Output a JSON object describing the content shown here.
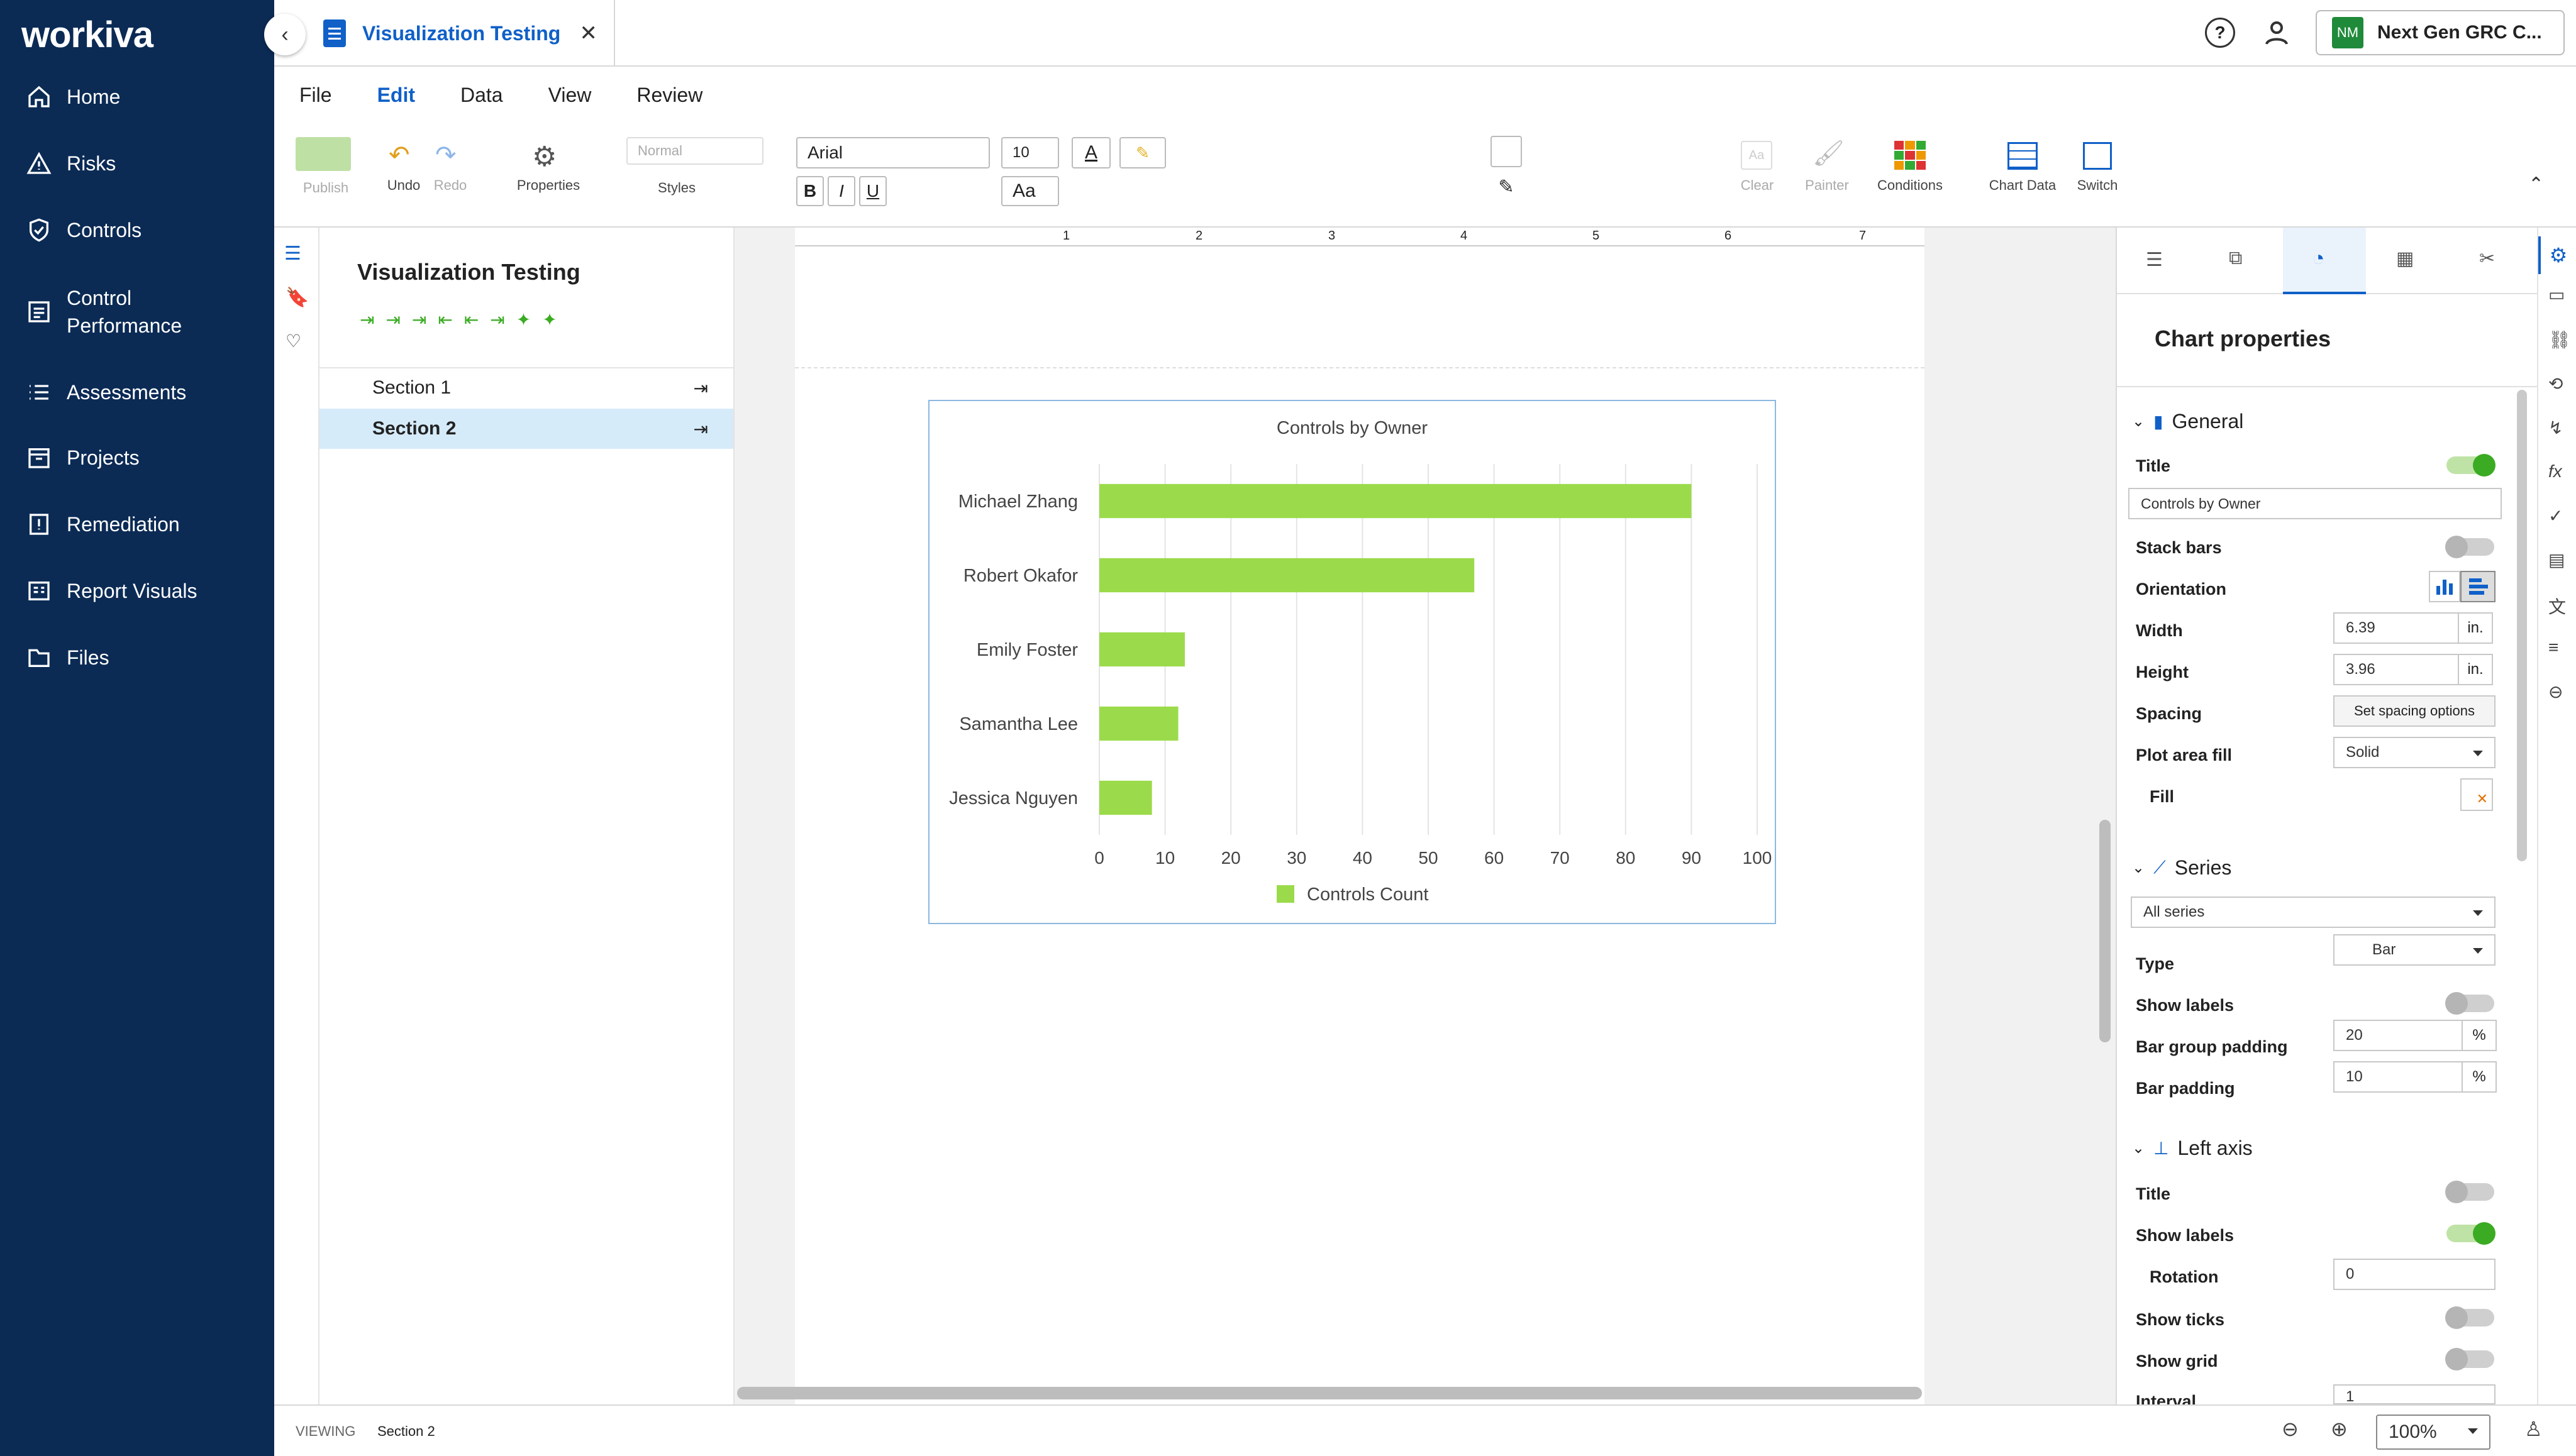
{
  "brand": {
    "logo": "workiva",
    "nav_bg": "#0b2b55",
    "accent": "#1060c8",
    "chart_green": "#9bdb4b"
  },
  "nav": {
    "items": [
      {
        "label": "Home",
        "icon": "home-icon"
      },
      {
        "label": "Risks",
        "icon": "warning-icon"
      },
      {
        "label": "Controls",
        "icon": "shield-icon"
      },
      {
        "label": "Control",
        "label2": "Performance",
        "icon": "performance-icon"
      },
      {
        "label": "Assessments",
        "icon": "list-icon"
      },
      {
        "label": "Projects",
        "icon": "projects-icon"
      },
      {
        "label": "Remediation",
        "icon": "remediation-icon"
      },
      {
        "label": "Report Visuals",
        "icon": "report-icon"
      },
      {
        "label": "Files",
        "icon": "folder-icon"
      }
    ]
  },
  "doc_tab": {
    "title": "Visualization Testing"
  },
  "account": {
    "initials": "NM",
    "name": "Next Gen GRC C..."
  },
  "menu": [
    "File",
    "Edit",
    "Data",
    "View",
    "Review"
  ],
  "toolbar": {
    "publish": "Publish",
    "undo": "Undo",
    "redo": "Redo",
    "properties": "Properties",
    "style_value": "Normal",
    "styles": "Styles",
    "font": "Arial",
    "size": "10",
    "case": "Aa",
    "clear": "Clear",
    "painter": "Painter",
    "conditions": "Conditions",
    "chart_data": "Chart Data",
    "switch": "Switch"
  },
  "outline": {
    "title": "Visualization Testing",
    "sections": [
      "Section 1",
      "Section 2"
    ]
  },
  "ruler": {
    "marks": [
      "1",
      "2",
      "3",
      "4",
      "5",
      "6",
      "7"
    ]
  },
  "chart_data": {
    "type": "bar",
    "orientation": "horizontal",
    "title": "Controls by Owner",
    "categories": [
      "Michael Zhang",
      "Robert Okafor",
      "Emily Foster",
      "Samantha Lee",
      "Jessica Nguyen"
    ],
    "series": [
      {
        "name": "Controls Count",
        "values": [
          90,
          57,
          13,
          12,
          8
        ]
      }
    ],
    "xlim": [
      0,
      100
    ],
    "xticks": [
      "0",
      "10",
      "20",
      "30",
      "40",
      "50",
      "60",
      "70",
      "80",
      "90",
      "100"
    ],
    "grid": true,
    "legend_position": "bottom"
  },
  "props": {
    "heading": "Chart properties",
    "general": "General",
    "title_label": "Title",
    "title_value": "Controls by Owner",
    "stack_bars": "Stack bars",
    "orientation": "Orientation",
    "width": "Width",
    "width_value": "6.39",
    "width_unit": "in.",
    "height": "Height",
    "height_value": "3.96",
    "height_unit": "in.",
    "spacing": "Spacing",
    "spacing_button": "Set spacing options",
    "plot_fill": "Plot area fill",
    "plot_fill_value": "Solid",
    "fill": "Fill",
    "series": "Series",
    "series_select": "All series",
    "type": "Type",
    "type_value": "Bar",
    "show_labels": "Show labels",
    "bar_group_padding": "Bar group padding",
    "bar_group_padding_value": "20",
    "bar_padding": "Bar padding",
    "bar_padding_value": "10",
    "pct": "%",
    "left_axis": "Left axis",
    "axis_title": "Title",
    "axis_show_labels": "Show labels",
    "rotation": "Rotation",
    "rotation_value": "0",
    "show_ticks": "Show ticks",
    "show_grid": "Show grid",
    "interval": "Interval",
    "interval_value": "1"
  },
  "status": {
    "mode": "VIEWING",
    "section": "Section 2",
    "zoom": "100%"
  }
}
